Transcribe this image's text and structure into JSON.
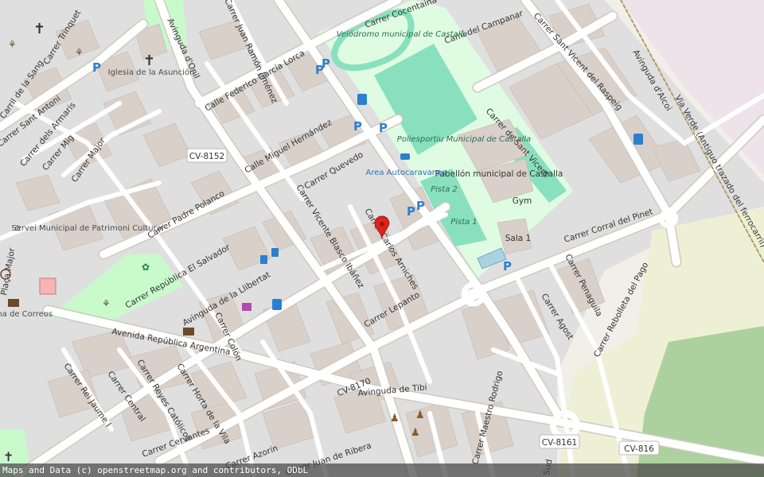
{
  "colors": {
    "land": "#f2efe9",
    "residential": "#e0dfdf",
    "building": "#d9d0c9",
    "road": "#ffffff",
    "road_casing": "#d4cfc6",
    "pitch": "#88e0be",
    "sport_area": "#dffce2",
    "park": "#c8facc",
    "farmland": "#eef0d5",
    "forest": "#add19e",
    "marker": "#e0241b",
    "parking_blue": "#2c7fd0"
  },
  "streets": [
    "Carrer Cocentaina",
    "Calle Federico García Lorca",
    "Carrer Trinquet",
    "Carril de la Sang",
    "Carrer Sant Antoni",
    "Carrer dels Armaris",
    "Carrer Mig",
    "Carrer Major",
    "Avinguda d'Onil",
    "Carrer Juan Ramón Jiménez",
    "Calle Miguel Hernández",
    "Carrer Quevedo",
    "Carrer Padre Polanco",
    "Carrer Vicente Blasco Ibáñez",
    "Carrer Carlos Arniches",
    "Carrer República El Salvador",
    "Avinguda de la Llibertat",
    "Carrer Lepanto",
    "Avenida República Argentina",
    "Carrer Colón",
    "Carrer Rei Jaume I",
    "Carrer Central",
    "Carrer Reyes Católicos",
    "Carrer Horta de la Vila",
    "Carrer Cervantes",
    "Carrer Azorín",
    "Avinguda de Tibi",
    "Carrer Juan de Ribera",
    "Carrer Maestro Rodrigo",
    "Camí del Campanar",
    "Carrer Sant Vicent del Raspeig",
    "Avinguda d'Alcoi",
    "Via Verde (Antiguo trazado del ferrocarril)",
    "Carrer de Sant Vicent",
    "Carrer Corral del Pinet",
    "Carrer Penaguila",
    "Carrer Agost",
    "Carrer Rebolleta del Pago",
    "Plaça Major",
    "Sud"
  ],
  "road_refs": [
    "CV-8152",
    "CV-8170",
    "CV-8161",
    "CV-816"
  ],
  "places": {
    "velodromo": "Velódromo municipal de Castalla",
    "poliesportiu": "Poliesportiu Municipal de Castalla",
    "pabellon": "Pabellón municipal de Castalla",
    "gym": "Gym",
    "pista1": "Pista 1",
    "pista2": "Pista 2",
    "sala1": "Sala 1",
    "iglesia": "Iglesia de la Asunción",
    "area_autocaravanes": "Area Autocaravanes",
    "servei": "Servei Municipal de Patrimoni Cultural",
    "correos": "Oficina de Correos"
  },
  "icons": [
    "church-icon",
    "parking-icon",
    "fuel-icon",
    "caravan-icon",
    "bus-stop-icon",
    "shop-icon",
    "charging-station-icon",
    "post-office-icon",
    "playground-icon",
    "museum-icon",
    "location-marker-icon",
    "information-icon",
    "bank-icon",
    "drinking-water-icon"
  ],
  "attribution": "Maps and Data (c) openstreetmap.org and contributors, ODbL"
}
